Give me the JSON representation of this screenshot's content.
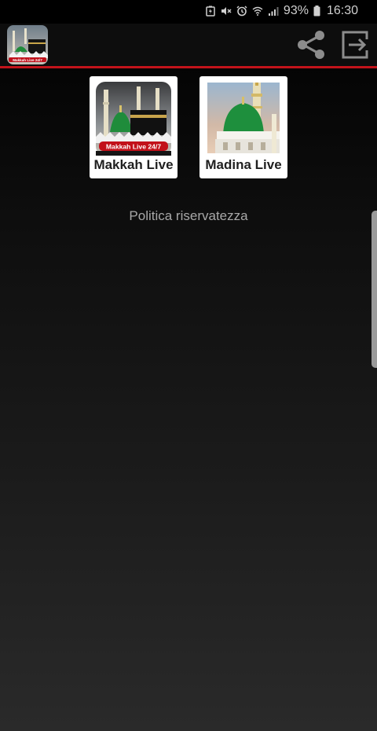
{
  "status_bar": {
    "battery_percent": "93%",
    "time": "16:30",
    "icons": [
      "battery-saver-icon",
      "mute-icon",
      "alarm-icon",
      "wifi-icon",
      "signal-icon",
      "battery-icon"
    ]
  },
  "app_bar": {
    "logo_text": "Makkah Live 24/7",
    "actions": [
      "share-icon",
      "exit-icon"
    ],
    "accent_color": "#c2131b"
  },
  "tiles": [
    {
      "label": "Makkah Live",
      "badge": "Makkah Live 24/7"
    },
    {
      "label": "Madina Live"
    }
  ],
  "privacy_link": "Politica riservatezza"
}
